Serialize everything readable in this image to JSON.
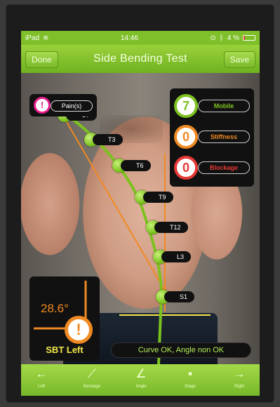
{
  "status": {
    "device": "iPad",
    "time": "14:46",
    "battery": "4 %"
  },
  "nav": {
    "done_label": "Done",
    "title": "Side Bending Test",
    "save_label": "Save"
  },
  "pain": {
    "badge": "!",
    "label": "Pain(s)"
  },
  "scores": [
    {
      "value": "7",
      "label": "Mobile",
      "color": "#7cc21f",
      "text_color": "#7cc21f"
    },
    {
      "value": "0",
      "label": "Stiffness",
      "color": "#f08a24",
      "text_color": "#f08a24"
    },
    {
      "value": "0",
      "label": "Blockage",
      "color": "#e53935",
      "text_color": "#e53935"
    }
  ],
  "vertebrae": [
    "C7",
    "T3",
    "T6",
    "T9",
    "T12",
    "L3",
    "S1"
  ],
  "angle": {
    "value": "28.6°",
    "warning": "!",
    "label": "SBT Left"
  },
  "verdict": "Curve OK, Angle non OK",
  "tabs": [
    {
      "icon": "arrow-left-icon",
      "glyph": "←",
      "label": "Left"
    },
    {
      "icon": "curve-icon",
      "glyph": "⟋",
      "label": "Bendage"
    },
    {
      "icon": "angle-icon",
      "glyph": "∠",
      "label": "Angle"
    },
    {
      "icon": "squares-icon",
      "glyph": "▪",
      "label": "Stage"
    },
    {
      "icon": "arrow-right-icon",
      "glyph": "→",
      "label": "Right"
    }
  ],
  "colors": {
    "accent_green": "#7cc21f",
    "orange": "#f08a24",
    "red": "#e53935",
    "pink": "#e91e8c",
    "yellow": "#f5e84a"
  }
}
